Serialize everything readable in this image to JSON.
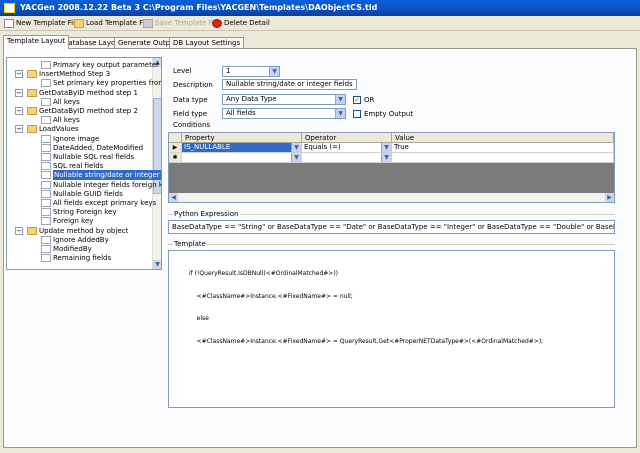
{
  "window": {
    "title": "YACGen 2008.12.22 Beta 3 C:\\Program Files\\YACGEN\\Templates\\DAObjectCS.tld"
  },
  "toolbar": {
    "new_template": "New Template File",
    "load_template": "Load Template File",
    "save_template": "Save Template File",
    "delete_detail": "Delete Detail"
  },
  "tabs": [
    "Template Layout",
    "Database Layout",
    "Generate Output",
    "DB Layout Settings"
  ],
  "tree": {
    "items": [
      {
        "label": "Primary key output parameter",
        "level": 2,
        "folder": false
      },
      {
        "label": "InsertMethod Step 3",
        "level": 1,
        "folder": true,
        "expander": "−"
      },
      {
        "label": "Set primary key properties from ca",
        "level": 2,
        "folder": false
      },
      {
        "label": "GetDataByID method step 1",
        "level": 1,
        "folder": true,
        "expander": "−"
      },
      {
        "label": "All keys",
        "level": 2,
        "folder": false
      },
      {
        "label": "GetDataByID method step 2",
        "level": 1,
        "folder": true,
        "expander": "−"
      },
      {
        "label": "All keys",
        "level": 2,
        "folder": false
      },
      {
        "label": "LoadValues",
        "level": 1,
        "folder": true,
        "expander": "−"
      },
      {
        "label": "Ignore image",
        "level": 2,
        "folder": false
      },
      {
        "label": "DateAdded, DateModified",
        "level": 2,
        "folder": false
      },
      {
        "label": "Nullable SQL real fields",
        "level": 2,
        "folder": false
      },
      {
        "label": "SQL real fields",
        "level": 2,
        "folder": false
      },
      {
        "label": "Nullable string/date or integer fie",
        "level": 2,
        "folder": false,
        "selected": true
      },
      {
        "label": "Nullable integer fields foreign key",
        "level": 2,
        "folder": false
      },
      {
        "label": "Nullable GUID fields",
        "level": 2,
        "folder": false
      },
      {
        "label": "All fields except primary keys",
        "level": 2,
        "folder": false
      },
      {
        "label": "String Foreign key",
        "level": 2,
        "folder": false
      },
      {
        "label": "Foreign key",
        "level": 2,
        "folder": false
      },
      {
        "label": "Update method by object",
        "level": 1,
        "folder": true,
        "expander": "−"
      },
      {
        "label": "Ignore AddedBy",
        "level": 2,
        "folder": false
      },
      {
        "label": "ModifiedBy",
        "level": 2,
        "folder": false
      },
      {
        "label": "Remaining fields",
        "level": 2,
        "folder": false
      }
    ]
  },
  "form": {
    "level_label": "Level",
    "level_value": "1",
    "description_label": "Description",
    "description_value": "Nullable string/date or integer fields",
    "datatype_label": "Data type",
    "datatype_value": "Any Data Type",
    "or_label": "OR",
    "or_checked": true,
    "fieldtype_label": "Field type",
    "fieldtype_value": "All fields",
    "empty_output_label": "Empty Output",
    "empty_output_checked": false,
    "conditions_label": "Conditions"
  },
  "conditions": {
    "columns": [
      "Property",
      "Operator",
      "Value"
    ],
    "rows": [
      {
        "marker": "▶",
        "property": "IS_NULLABLE",
        "operator": "Equals (=)",
        "value": "True"
      },
      {
        "marker": "✱",
        "property": "",
        "operator": "",
        "value": ""
      }
    ]
  },
  "python": {
    "label": "Python Expression",
    "expression": "BaseDataType == \"String\" or BaseDataType == \"Date\" or BaseDataType == \"Integer\" or BaseDataType == \"Double\" or BaseDataType == \"Currency\""
  },
  "template": {
    "label": "Template",
    "lines": [
      "if (!QueryResult.IsDBNull(<#OrdinalMatched#>))",
      "    <#ClassName#>Instance.<#FixedName#> = null;",
      "    else",
      "    <#ClassName#>Instance.<#FixedName#> = QueryResult.Get<#ProperNETDataType#>(<#OrdinalMatched#>);"
    ]
  },
  "colors": {
    "title_bar": "#0b56c9",
    "selection": "#316ac5",
    "grid_empty": "#7b7b7b"
  },
  "icons": [
    "app-icon",
    "new-file-icon",
    "load-file-icon",
    "save-file-icon",
    "delete-icon",
    "folder-icon",
    "expand-icon",
    "dropdown-icon",
    "check-icon"
  ]
}
